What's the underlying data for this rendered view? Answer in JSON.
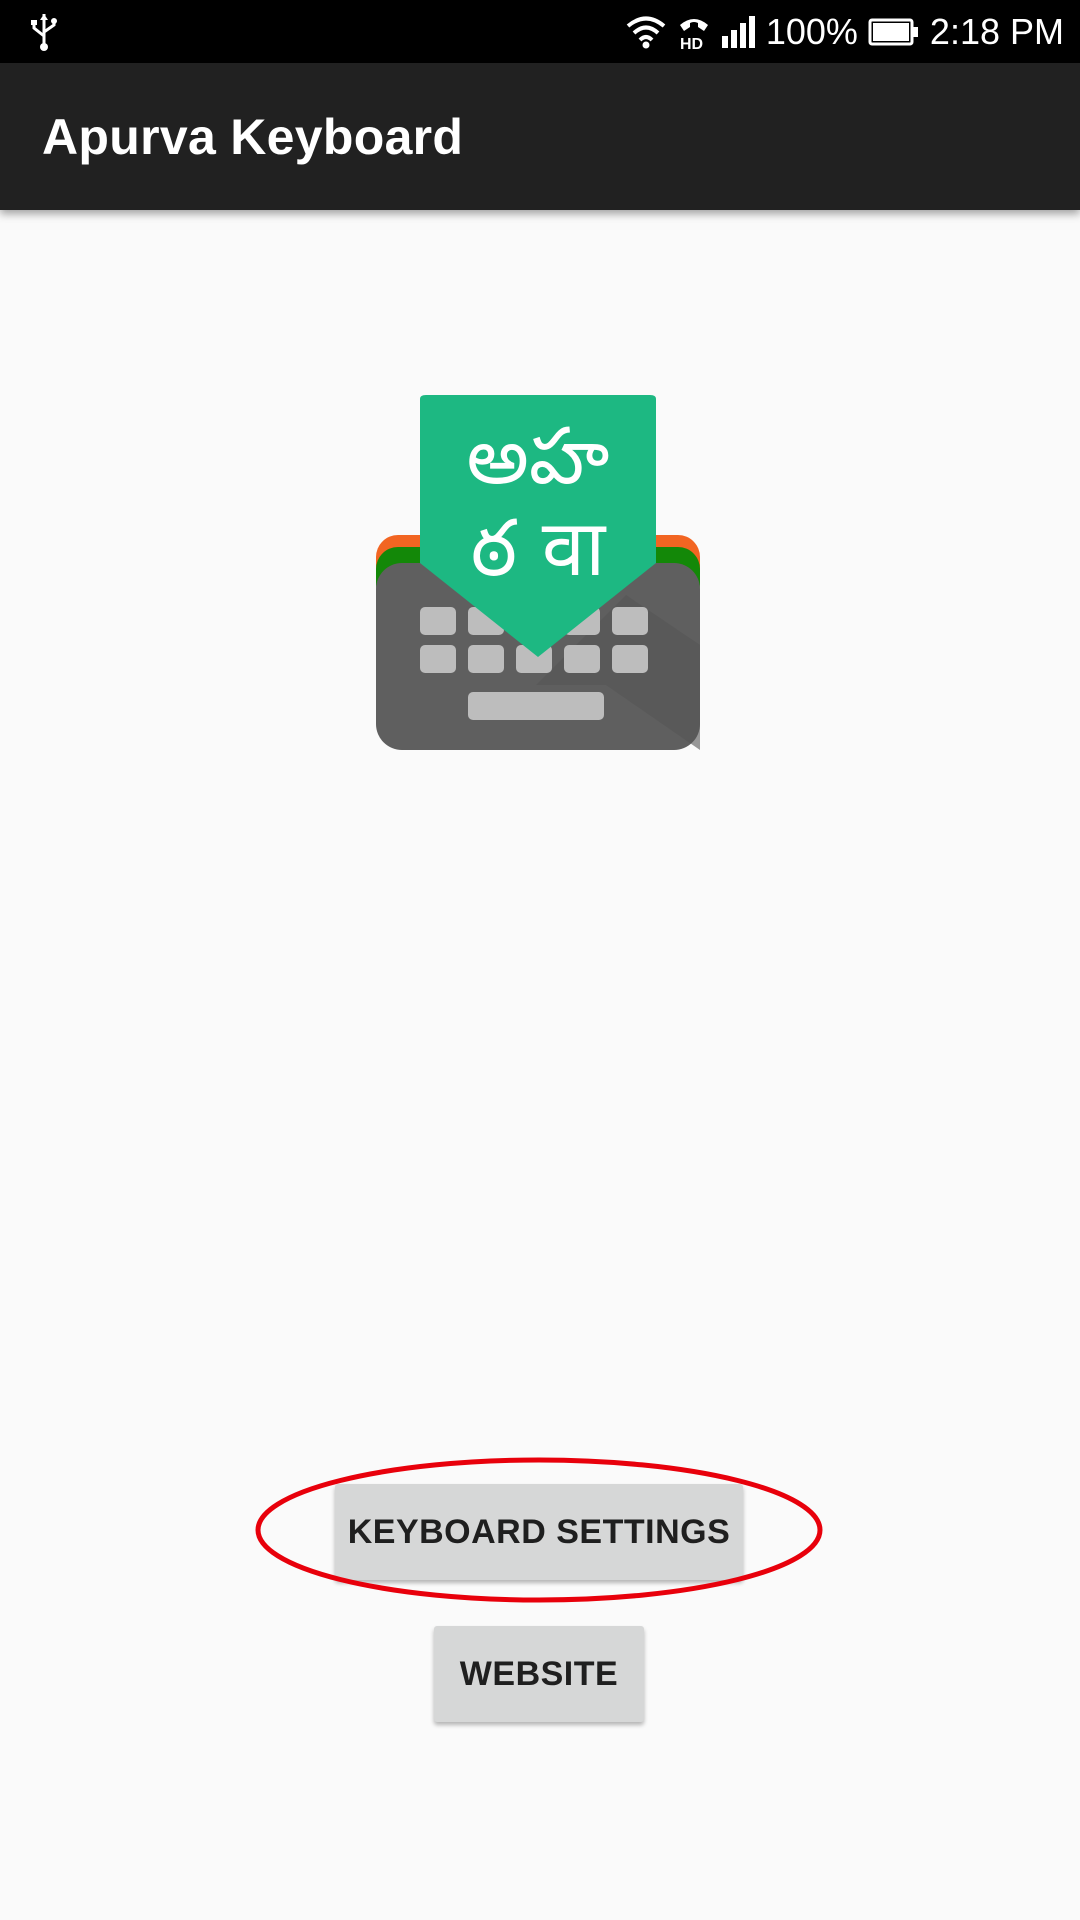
{
  "status_bar": {
    "battery_percent": "100%",
    "time": "2:18 PM",
    "battery_level": 1.0,
    "network_label": "HD",
    "icons": [
      "usb-icon",
      "wifi-icon",
      "hd-call-icon",
      "cell-signal-icon",
      "battery-icon"
    ]
  },
  "app_bar": {
    "title": "Apurva Keyboard"
  },
  "logo": {
    "glyph_top": "అహ",
    "glyph_bottom": "ఠ वा",
    "colors": {
      "flag_green": "#1db882",
      "keyboard_gray": "#5f5f5f",
      "key_gray": "#bdbdbd",
      "saffron": "#f26522",
      "india_green": "#138808"
    }
  },
  "buttons": {
    "keyboard_settings": "KEYBOARD SETTINGS",
    "website": "WEBSITE"
  },
  "annotation": {
    "highlight_color": "#e8000b"
  }
}
